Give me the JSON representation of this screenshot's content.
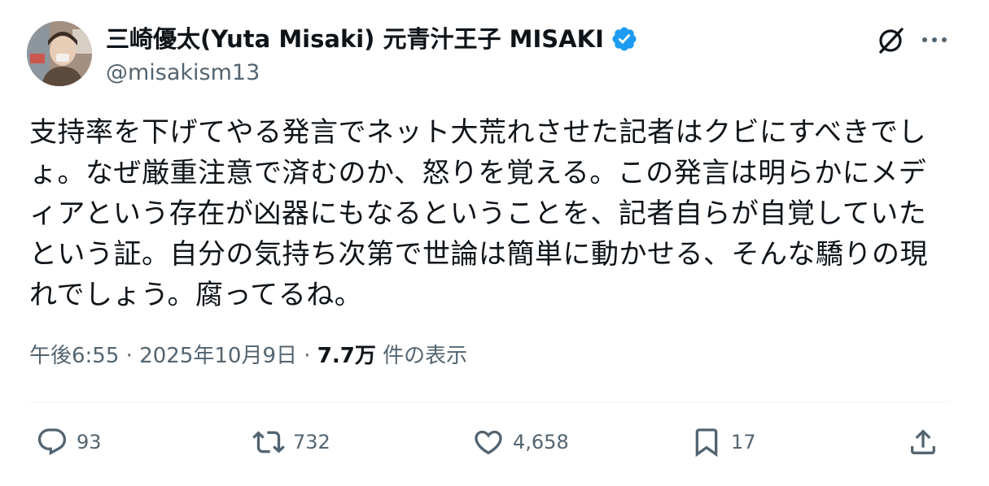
{
  "author": {
    "display_name": "三崎優太(Yuta Misaki) 元青汁王子 MISAKI",
    "handle": "@misakism13",
    "verified": true,
    "verified_color": "#1d9bf0",
    "avatar_icon": "profile-photo"
  },
  "header_actions": {
    "grok_icon": "grok-icon",
    "more_icon": "more-icon"
  },
  "tweet": {
    "text": "支持率を下げてやる発言でネット大荒れさせた記者はクビにすべきでしょ。なぜ厳重注意で済むのか、怒りを覚える。この発言は明らかにメディアという存在が凶器にもなるということを、記者自らが自覚していたという証。自分の気持ち次第で世論は簡単に動かせる、そんな驕りの現れでしょう。腐ってるね。"
  },
  "meta": {
    "time": "午後6:55",
    "separator": "·",
    "date": "2025年10月9日",
    "views": "7.7万",
    "views_label": "件の表示"
  },
  "actions": {
    "replies": "93",
    "retweets": "732",
    "likes": "4,658",
    "bookmarks": "17"
  },
  "colors": {
    "text": "#0f1419",
    "secondary": "#536471",
    "divider": "#eff3f4"
  }
}
